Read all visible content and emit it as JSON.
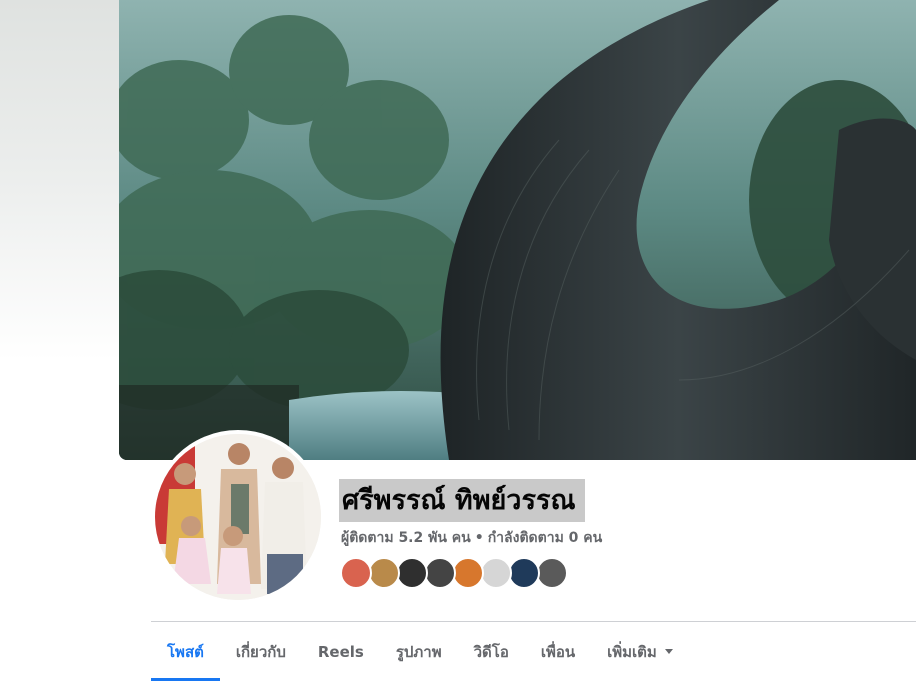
{
  "profile": {
    "name": "ศรีพรรณ์ ทิพย์วรรณ",
    "followers": "ผู้ติดตาม 5.2 พัน คน",
    "separator": "•",
    "following": "กำลังติดตาม 0 คน"
  },
  "friends": [
    {
      "color": "#d9634f"
    },
    {
      "color": "#b98a4a"
    },
    {
      "color": "#2f2f2f"
    },
    {
      "color": "#444444"
    },
    {
      "color": "#d7772d"
    },
    {
      "color": "#d6d6d6"
    },
    {
      "color": "#1f3a5a"
    },
    {
      "color": "#5a5a5a"
    }
  ],
  "tabs": [
    {
      "label": "โพสต์",
      "active": true
    },
    {
      "label": "เกี่ยวกับ",
      "active": false
    },
    {
      "label": "Reels",
      "active": false
    },
    {
      "label": "รูปภาพ",
      "active": false
    },
    {
      "label": "วิดีโอ",
      "active": false
    },
    {
      "label": "เพื่อน",
      "active": false
    },
    {
      "label": "เพิ่มเติม",
      "active": false,
      "icon": "caret-down-icon"
    }
  ],
  "colors": {
    "accent": "#1877f2",
    "secondary_text": "#65676b",
    "primary_text": "#050505"
  }
}
